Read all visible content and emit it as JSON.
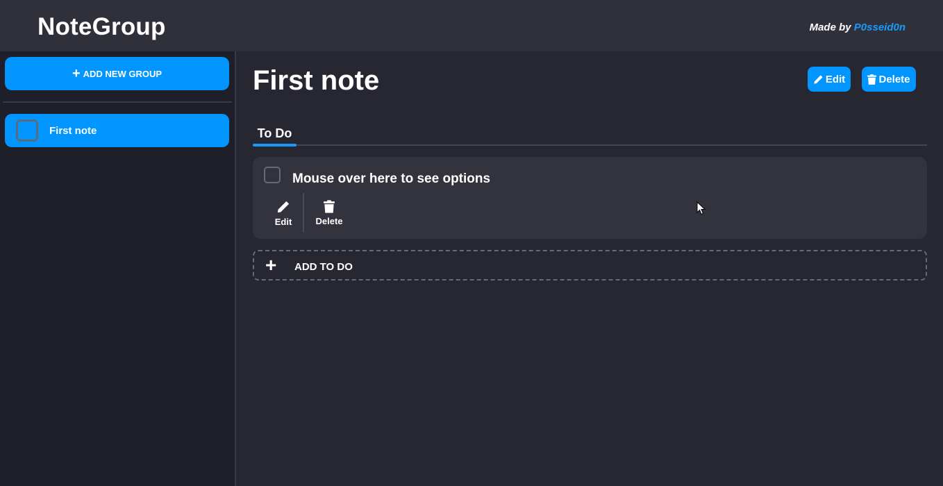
{
  "header": {
    "title": "NoteGroup",
    "made_by_prefix": "Made by",
    "author": "P0sseid0n",
    "author_color": "#1a9aff"
  },
  "sidebar": {
    "add_group_label": "ADD NEW GROUP",
    "add_group_icon": "plus-icon",
    "groups": [
      {
        "label": "First note",
        "selected": true
      }
    ]
  },
  "main": {
    "note_title": "First note",
    "edit_label": "Edit",
    "delete_label": "Delete",
    "tabs": [
      {
        "label": "To Do",
        "active": true
      }
    ],
    "todos": [
      {
        "text": "Mouse over here to see options",
        "checked": false,
        "actions": [
          {
            "label": "Edit",
            "icon": "pencil-icon"
          },
          {
            "label": "Delete",
            "icon": "trash-icon"
          }
        ]
      }
    ],
    "add_todo_label": "ADD TO DO"
  },
  "colors": {
    "accent": "#0095ff",
    "header_bg": "#30303b",
    "sidebar_bg": "#1f1f29",
    "main_bg": "#272731",
    "card_bg": "#33333d"
  }
}
